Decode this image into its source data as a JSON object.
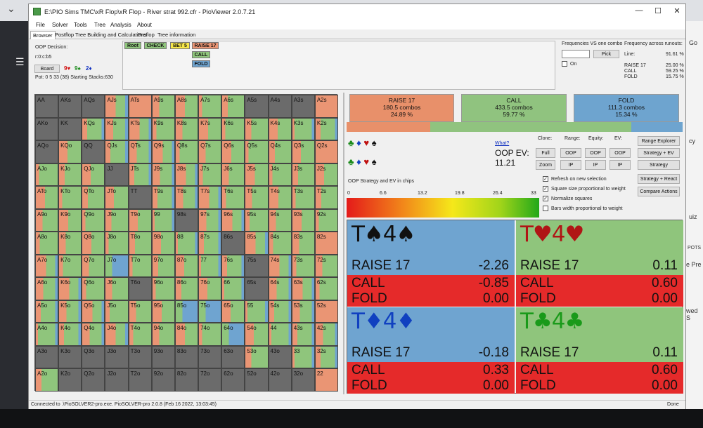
{
  "window": {
    "title": "E:\\PIO Sims TMC\\xR Flop\\xR Flop - River strat 992.cfr - PioViewer 2.0.7.21",
    "minimize": "—",
    "maximize": "☐",
    "close": "✕"
  },
  "menu": [
    "File",
    "Solver",
    "Tools",
    "Tree",
    "Analysis",
    "About"
  ],
  "tabs": [
    "Browser",
    "Postflop Tree Building and Calculations",
    "Preflop",
    "Tree information"
  ],
  "decision": {
    "label": "OOP Decision:",
    "line": "r:0:c:b5",
    "board_button": "Board",
    "board_cards": [
      {
        "text": "9♥",
        "color": "#d01010"
      },
      {
        "text": "9♠",
        "color": "#1a8a1a"
      },
      {
        "text": "2♦",
        "color": "#1030c0"
      }
    ],
    "pot": "Pot: 0 5 33 (38) Starting Stacks:630"
  },
  "tree": {
    "root": "Root",
    "check": "CHECK",
    "bet": "BET 5",
    "raise": "RAISE 17",
    "call": "CALL",
    "fold": "FOLD"
  },
  "freq_panel": {
    "title": "Frequencies VS one combo",
    "pick_button": "Pick",
    "on_label": "On",
    "runouts_title": "Frequency across runouts:",
    "line_label": "Line:",
    "line_value": "91.61 %",
    "actions": [
      {
        "name": "RAISE 17",
        "value": "25.00 %"
      },
      {
        "name": "CALL",
        "value": "59.25 %"
      },
      {
        "name": "FOLD",
        "value": "15.75 %"
      }
    ]
  },
  "summary": [
    {
      "name": "RAISE 17",
      "combos": "180.5 combos",
      "pct": "24.89 %",
      "color": "#e8906a",
      "share": 0.2489
    },
    {
      "name": "CALL",
      "combos": "433.5 combos",
      "pct": "59.77 %",
      "color": "#90c37f",
      "share": 0.5977
    },
    {
      "name": "FOLD",
      "combos": "111.3 combos",
      "pct": "15.34 %",
      "color": "#6ea4cf",
      "share": 0.1534
    }
  ],
  "controls": {
    "what": "What?",
    "ev_label": "OOP EV:",
    "ev_value": "11.21",
    "clone": "Clone:",
    "range": "Range:",
    "equity": "Equity:",
    "ev": "EV:",
    "full": "Full",
    "zoom": "Zoom",
    "range_oop": "OOP",
    "range_ip": "IP",
    "eq_oop": "OOP",
    "eq_ip": "IP",
    "ev_oop": "OOP",
    "ev_ip": "IP",
    "range_explorer": "Range Explorer",
    "strategy_ev": "Strategy + EV",
    "strategy": "Strategy",
    "strategy_react": "Strategy + React",
    "compare_actions": "Compare Actions",
    "strategy_chips": "OOP Strategy and EV in chips",
    "scale": [
      "0",
      "6.6",
      "13.2",
      "19.8",
      "26.4",
      "33"
    ],
    "checks": [
      {
        "label": "Refresh on new selection",
        "checked": "✓"
      },
      {
        "label": "Square size proportional to weight",
        "checked": "✓"
      },
      {
        "label": "Normalize squares",
        "checked": "✓"
      },
      {
        "label": "Bars width proportional to weight",
        "checked": ""
      }
    ]
  },
  "combos": [
    {
      "hand": "T♠4♠",
      "color": "#111111",
      "raise": "-2.26",
      "call": "-0.85",
      "fold": "0.00"
    },
    {
      "hand": "T♥4♥",
      "color": "#b01515",
      "raise": "0.11",
      "call": "0.60",
      "fold": "0.00"
    },
    {
      "hand": "T♦4♦",
      "color": "#1040c0",
      "raise": "-0.18",
      "call": "0.33",
      "fold": "0.00"
    },
    {
      "hand": "T♣4♣",
      "color": "#1a9a1a",
      "raise": "0.11",
      "call": "0.60",
      "fold": "0.00"
    }
  ],
  "combo_labels": {
    "raise": "RAISE 17",
    "call": "CALL",
    "fold": "FOLD"
  },
  "grid": {
    "ranks": [
      "A",
      "K",
      "Q",
      "J",
      "T",
      "9",
      "8",
      "7",
      "6",
      "5",
      "4",
      "3",
      "2"
    ],
    "raise_color": "#ea9574",
    "call_color": "#8fc57c",
    "fold_color": "#6fa4d0",
    "empty_color": "#6b6b6b"
  },
  "status": {
    "left": "Connected to .\\PioSOLVER2-pro.exe. PioSOLVER-pro 2.0.8 (Feb 16 2022, 13:03:45)",
    "right": "Done"
  },
  "background": {
    "chevron": "⌄",
    "back": "←",
    "hamburger": "☰",
    "right_texts": [
      "Go",
      "cy",
      "uiz",
      "POTS",
      "e Pre",
      "wed S"
    ]
  }
}
